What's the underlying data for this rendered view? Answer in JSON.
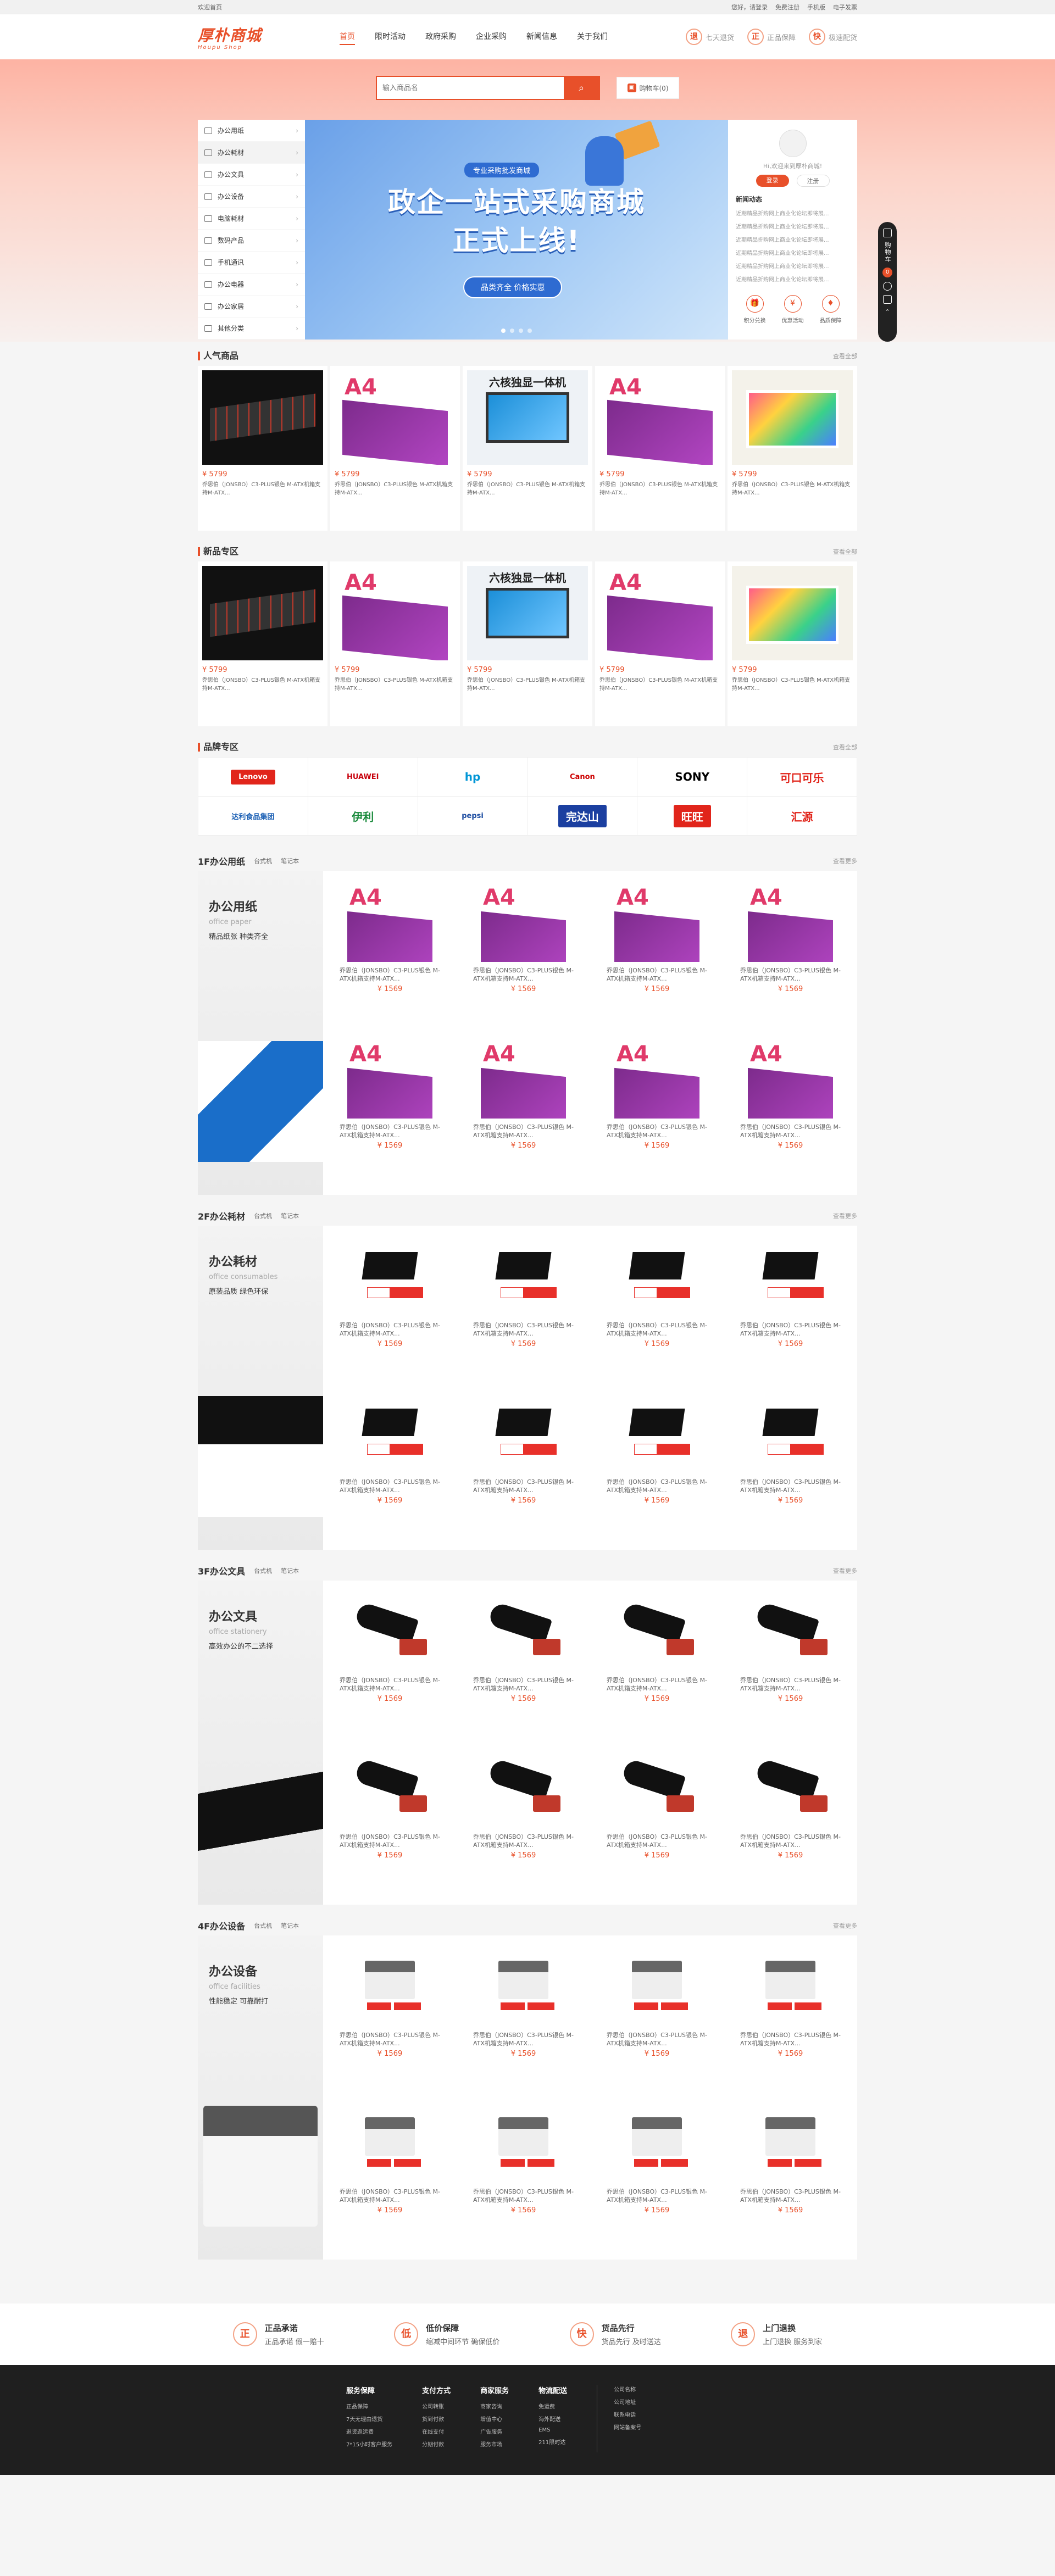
{
  "topbar": {
    "home": "欢迎首页",
    "links": [
      "您好，请登录",
      "免费注册",
      "手机版",
      "电子发票"
    ]
  },
  "header": {
    "logo": "厚朴商城",
    "logo_en": "Houpu Shop",
    "nav": [
      "首页",
      "限时活动",
      "政府采购",
      "企业采购",
      "新闻信息",
      "关于我们"
    ],
    "promises": [
      {
        "icon": "退",
        "label": "七天退货"
      },
      {
        "icon": "正",
        "label": "正品保障"
      },
      {
        "icon": "快",
        "label": "极速配货"
      }
    ]
  },
  "search": {
    "placeholder": "输入商品名",
    "cart_label": "购物车(0)"
  },
  "categories": [
    "办公用纸",
    "办公耗材",
    "办公文具",
    "办公设备",
    "电脑耗材",
    "数码产品",
    "手机通讯",
    "办公电器",
    "办公家居",
    "其他分类"
  ],
  "banner": {
    "tag": "专业采购批发商城",
    "headline_1": "政企一站式采购商城",
    "headline_2": "正式上线!",
    "pill": "品类齐全 价格实惠"
  },
  "user": {
    "welcome": "Hi,欢迎来到厚朴商城!",
    "login": "登录",
    "register": "注册",
    "news_title": "新闻动态",
    "news": [
      "近期精品折购网上商业化论坛即将展...",
      "近期精品折购网上商业化论坛即将展...",
      "近期精品折购网上商业化论坛即将展...",
      "近期精品折购网上商业化论坛即将展...",
      "近期精品折购网上商业化论坛即将展...",
      "近期精品折购网上商业化论坛即将展..."
    ],
    "icons": [
      {
        "glyph": "🎁",
        "label": "积分兑换"
      },
      {
        "glyph": "¥",
        "label": "优惠活动"
      },
      {
        "glyph": "♦",
        "label": "品质保障"
      }
    ]
  },
  "sidebar": {
    "cart": "购物车",
    "count": "0"
  },
  "popular": {
    "title": "人气商品",
    "more": "查看全部",
    "items": [
      {
        "img": "kb",
        "price": "¥ 5799",
        "name": "乔思伯（JONSBO）C3-PLUS银色 M-ATX机箱支持M-ATX..."
      },
      {
        "img": "paper",
        "price": "¥ 5799",
        "name": "乔思伯（JONSBO）C3-PLUS银色 M-ATX机箱支持M-ATX..."
      },
      {
        "img": "pc",
        "price": "¥ 5799",
        "name": "乔思伯（JONSBO）C3-PLUS银色 M-ATX机箱支持M-ATX..."
      },
      {
        "img": "paper",
        "price": "¥ 5799",
        "name": "乔思伯（JONSBO）C3-PLUS银色 M-ATX机箱支持M-ATX..."
      },
      {
        "img": "imac",
        "price": "¥ 5799",
        "name": "乔思伯（JONSBO）C3-PLUS银色 M-ATX机箱支持M-ATX..."
      }
    ]
  },
  "newarrivals": {
    "title": "新品专区",
    "more": "查看全部",
    "items": [
      {
        "img": "kb",
        "price": "¥ 5799",
        "name": "乔思伯（JONSBO）C3-PLUS银色 M-ATX机箱支持M-ATX..."
      },
      {
        "img": "paper",
        "price": "¥ 5799",
        "name": "乔思伯（JONSBO）C3-PLUS银色 M-ATX机箱支持M-ATX..."
      },
      {
        "img": "pc",
        "price": "¥ 5799",
        "name": "乔思伯（JONSBO）C3-PLUS银色 M-ATX机箱支持M-ATX..."
      },
      {
        "img": "paper",
        "price": "¥ 5799",
        "name": "乔思伯（JONSBO）C3-PLUS银色 M-ATX机箱支持M-ATX..."
      },
      {
        "img": "imac",
        "price": "¥ 5799",
        "name": "乔思伯（JONSBO）C3-PLUS银色 M-ATX机箱支持M-ATX..."
      }
    ]
  },
  "pc_label": "六核独显一体机",
  "brands": {
    "title": "品牌专区",
    "more": "查看全部",
    "items": [
      {
        "name": "Lenovo",
        "color": "#fff",
        "bg": "#e1251b"
      },
      {
        "name": "HUAWEI",
        "color": "#c7000b",
        "bg": "#fff"
      },
      {
        "name": "hp",
        "color": "#0096d6",
        "bg": "#fff"
      },
      {
        "name": "Canon",
        "color": "#cc0000",
        "bg": "#fff"
      },
      {
        "name": "SONY",
        "color": "#000",
        "bg": "#fff"
      },
      {
        "name": "可口可乐",
        "color": "#e1251b",
        "bg": "#fff"
      },
      {
        "name": "达利食品集团",
        "color": "#1a5fb4",
        "bg": "#fff"
      },
      {
        "name": "伊利",
        "color": "#1a8a3c",
        "bg": "#fff"
      },
      {
        "name": "pepsi",
        "color": "#1b4ba0",
        "bg": "#fff"
      },
      {
        "name": "完达山",
        "color": "#fff",
        "bg": "#1b3fa0"
      },
      {
        "name": "旺旺",
        "color": "#fff",
        "bg": "#e1251b"
      },
      {
        "name": "汇源",
        "color": "#e1251b",
        "bg": "#fff"
      }
    ]
  },
  "floors": [
    {
      "title": "1F办公用纸",
      "tabs": [
        "台式机",
        "笔记本"
      ],
      "more": "查看更多",
      "zh": "办公用纸",
      "en": "office paper",
      "sub": "精品纸张 种类齐全",
      "bg": "paper",
      "img": "paper"
    },
    {
      "title": "2F办公耗材",
      "tabs": [
        "台式机",
        "笔记本"
      ],
      "more": "查看更多",
      "zh": "办公耗材",
      "en": "office consumables",
      "sub": "原装品质 绿色环保",
      "bg": "toner",
      "img": "toner"
    },
    {
      "title": "3F办公文具",
      "tabs": [
        "台式机",
        "笔记本"
      ],
      "more": "查看更多",
      "zh": "办公文具",
      "en": "office stationery",
      "sub": "高效办公的不二选择",
      "bg": "stapler",
      "img": "stapler"
    },
    {
      "title": "4F办公设备",
      "tabs": [
        "台式机",
        "笔记本"
      ],
      "more": "查看更多",
      "zh": "办公设备",
      "en": "office facilities",
      "sub": "性能稳定 可靠耐打",
      "bg": "printer",
      "img": "printer"
    }
  ],
  "floor_item": {
    "name": "乔思伯（JONSBO）C3-PLUS银色 M-ATX机箱支持M-ATX...",
    "price": "¥ 1569"
  },
  "services": [
    {
      "icon": "正",
      "title": "正品承诺",
      "desc": "正品承诺 假一赔十"
    },
    {
      "icon": "低",
      "title": "低价保障",
      "desc": "缩减中间环节 确保低价"
    },
    {
      "icon": "快",
      "title": "货品先行",
      "desc": "货品先行 及时送达"
    },
    {
      "icon": "退",
      "title": "上门退换",
      "desc": "上门退换 服务到家"
    }
  ],
  "footer": [
    {
      "title": "服务保障",
      "items": [
        "正品保障",
        "7天无理由退货",
        "退货返运费",
        "7*15小时客户服务"
      ]
    },
    {
      "title": "支付方式",
      "items": [
        "公司转账",
        "货到付款",
        "在线支付",
        "分期付款"
      ]
    },
    {
      "title": "商家服务",
      "items": [
        "商家咨询",
        "增值中心",
        "广告服务",
        "服务市场"
      ]
    },
    {
      "title": "物流配送",
      "items": [
        "免运费",
        "海外配送",
        "EMS",
        "211限时达"
      ]
    },
    {
      "title": "",
      "items": [
        "公司名称",
        "公司地址",
        "联系电话",
        "网站备案号"
      ]
    }
  ]
}
